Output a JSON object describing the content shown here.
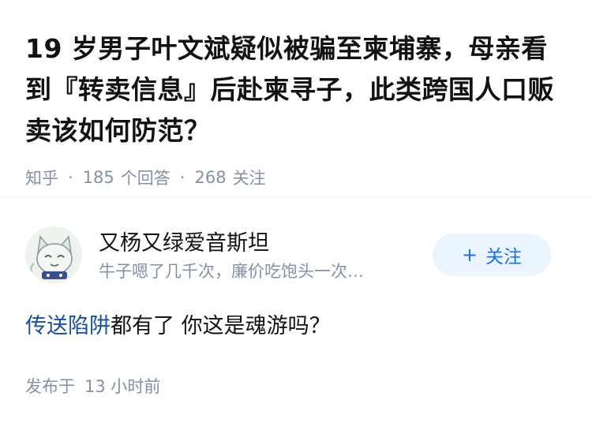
{
  "question": {
    "title": "19 岁男子叶文斌疑似被骗至柬埔寨，母亲看到『转卖信息』后赴柬寻子，此类跨国人口贩卖该如何防范？",
    "source": "知乎",
    "answer_count": "185",
    "answer_label": "个回答",
    "follower_count": "268",
    "follower_label": "关注"
  },
  "author": {
    "name": "又杨又绿爱音斯坦",
    "bio": "牛子嗯了几千次，廉价吃饱头一次…",
    "follow_label": "关注",
    "avatar_icon": "cartoon-avatar-icon"
  },
  "answer": {
    "link_text": "传送陷阱",
    "text": "都有了 你这是魂游吗？"
  },
  "published": {
    "label": "发布于",
    "time": "13 小时前"
  },
  "colors": {
    "link": "#175199",
    "accent": "#1772f6",
    "meta": "#8590a6",
    "follow_bg": "#ebf5ff"
  }
}
